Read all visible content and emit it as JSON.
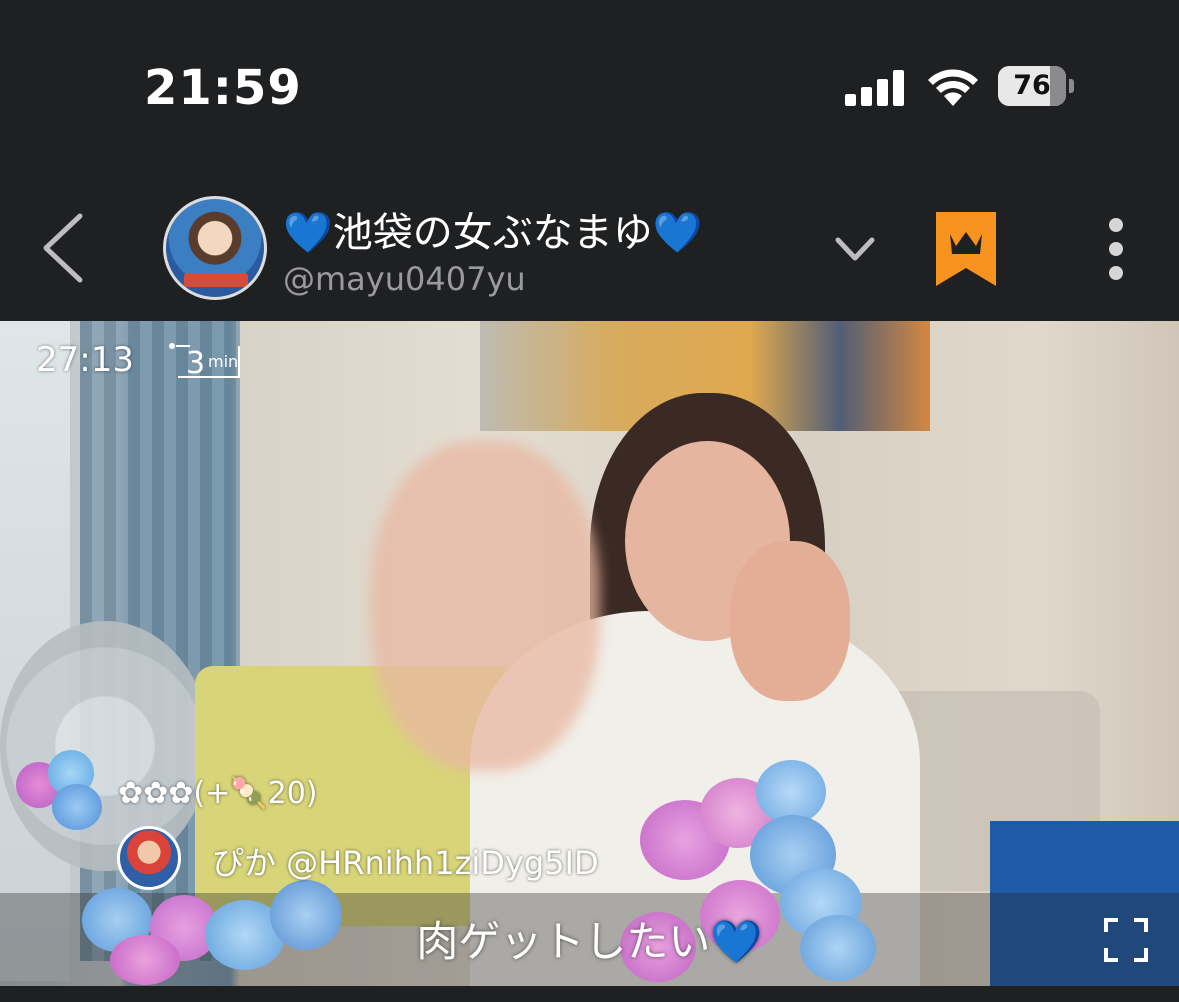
{
  "status_bar": {
    "time": "21:59",
    "battery_percent": "76",
    "signal_bars": 4,
    "wifi": true
  },
  "header": {
    "title": "💙池袋の女ぶなまゆ💙",
    "handle": "@mayu0407yu",
    "icons": [
      "back-chevron-icon",
      "avatar",
      "chevron-down-icon",
      "crown-bookmark-icon",
      "more-vertical-icon"
    ],
    "bookmark_color": "#f7931e"
  },
  "stream": {
    "elapsed": "27:13",
    "rewind_amount": "3",
    "rewind_unit": "min",
    "gift_line": "✿✿✿(+🍡20)",
    "comment": "ぴか @HRnihh1ziDyg5ID",
    "caption": "肉ゲットしたい💙"
  }
}
